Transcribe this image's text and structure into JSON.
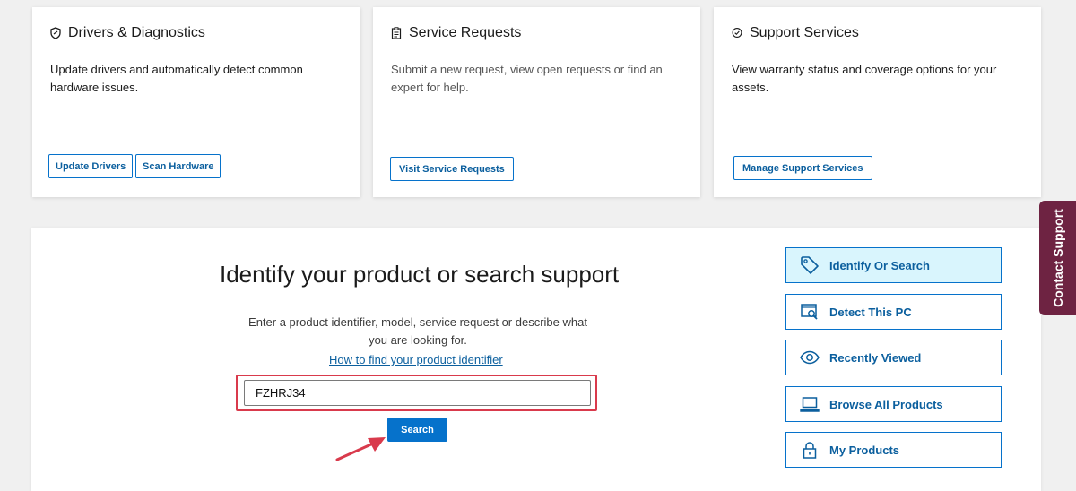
{
  "cards": [
    {
      "title": "Drivers & Diagnostics",
      "icon": "shield-icon",
      "description_line1": "Update drivers and automatically detect common",
      "description_line2": "hardware issues.",
      "buttons": [
        "Update Drivers",
        "Scan Hardware"
      ]
    },
    {
      "title": "Service Requests",
      "icon": "clipboard-icon",
      "description_line1": "Submit a new request, view open requests or find an",
      "description_line2": "expert for help.",
      "buttons": [
        "Visit Service Requests"
      ]
    },
    {
      "title": "Support Services",
      "icon": "check-badge-icon",
      "description_line1": "View warranty status and coverage options for your",
      "description_line2": "assets.",
      "buttons": [
        "Manage Support Services"
      ]
    }
  ],
  "search_panel": {
    "headline": "Identify your product or search support",
    "subtext_line1": "Enter a product identifier, model, service request or describe what",
    "subtext_line2": "you are looking for.",
    "help_link": "How to find your product identifier",
    "input_value": "FZHRJ34",
    "search_button": "Search"
  },
  "side_menu": [
    {
      "label": "Identify Or Search",
      "icon": "tag-icon",
      "active": true
    },
    {
      "label": "Detect This PC",
      "icon": "detect-pc-icon",
      "active": false
    },
    {
      "label": "Recently Viewed",
      "icon": "eye-icon",
      "active": false
    },
    {
      "label": "Browse All Products",
      "icon": "laptop-icon",
      "active": false
    },
    {
      "label": "My Products",
      "icon": "lock-icon",
      "active": false
    }
  ],
  "contact_tab": "Contact Support",
  "colors": {
    "accent_blue": "#0672cb",
    "link_blue": "#0b5f9e",
    "active_bg": "#d9f5fd",
    "highlight_red": "#d93a4c",
    "contact_bg": "#6e2342"
  }
}
